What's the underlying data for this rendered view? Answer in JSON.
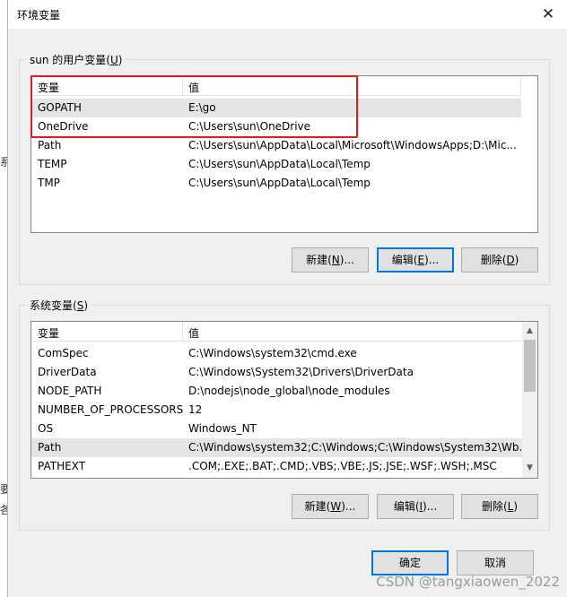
{
  "window": {
    "title": "环境变量",
    "close_glyph": "✕"
  },
  "background": {
    "char1": "系",
    "char2": "要",
    "char3": "各"
  },
  "user_group": {
    "label": "sun 的用户变量(",
    "label_accel": "U",
    "label_end": ")",
    "headers": {
      "name": "变量",
      "value": "值"
    },
    "rows": [
      {
        "name": "GOPATH",
        "value": "E:\\go"
      },
      {
        "name": "OneDrive",
        "value": "C:\\Users\\sun\\OneDrive"
      },
      {
        "name": "Path",
        "value": "C:\\Users\\sun\\AppData\\Local\\Microsoft\\WindowsApps;D:\\Mic..."
      },
      {
        "name": "TEMP",
        "value": "C:\\Users\\sun\\AppData\\Local\\Temp"
      },
      {
        "name": "TMP",
        "value": "C:\\Users\\sun\\AppData\\Local\\Temp"
      }
    ],
    "buttons": {
      "new": {
        "pre": "新建(",
        "accel": "N",
        "post": ")..."
      },
      "edit": {
        "pre": "编辑(",
        "accel": "E",
        "post": ")..."
      },
      "delete": {
        "pre": "删除(",
        "accel": "D",
        "post": ")"
      }
    }
  },
  "system_group": {
    "label": "系统变量(",
    "label_accel": "S",
    "label_end": ")",
    "headers": {
      "name": "变量",
      "value": "值"
    },
    "rows": [
      {
        "name": "ComSpec",
        "value": "C:\\Windows\\system32\\cmd.exe"
      },
      {
        "name": "DriverData",
        "value": "C:\\Windows\\System32\\Drivers\\DriverData"
      },
      {
        "name": "NODE_PATH",
        "value": "D:\\nodejs\\node_global\\node_modules"
      },
      {
        "name": "NUMBER_OF_PROCESSORS",
        "value": "12"
      },
      {
        "name": "OS",
        "value": "Windows_NT"
      },
      {
        "name": "Path",
        "value": "C:\\Windows\\system32;C:\\Windows;C:\\Windows\\System32\\Wb..."
      },
      {
        "name": "PATHEXT",
        "value": ".COM;.EXE;.BAT;.CMD;.VBS;.VBE;.JS;.JSE;.WSF;.WSH;.MSC"
      }
    ],
    "scroll_up": "▲",
    "scroll_down": "▼",
    "buttons": {
      "new": {
        "pre": "新建(",
        "accel": "W",
        "post": ")..."
      },
      "edit": {
        "pre": "编辑(",
        "accel": "I",
        "post": ")..."
      },
      "delete": {
        "pre": "删除(",
        "accel": "L",
        "post": ")"
      }
    }
  },
  "footer": {
    "ok": "确定",
    "cancel": "取消"
  },
  "watermark": "CSDN @tangxiaowen_2022"
}
